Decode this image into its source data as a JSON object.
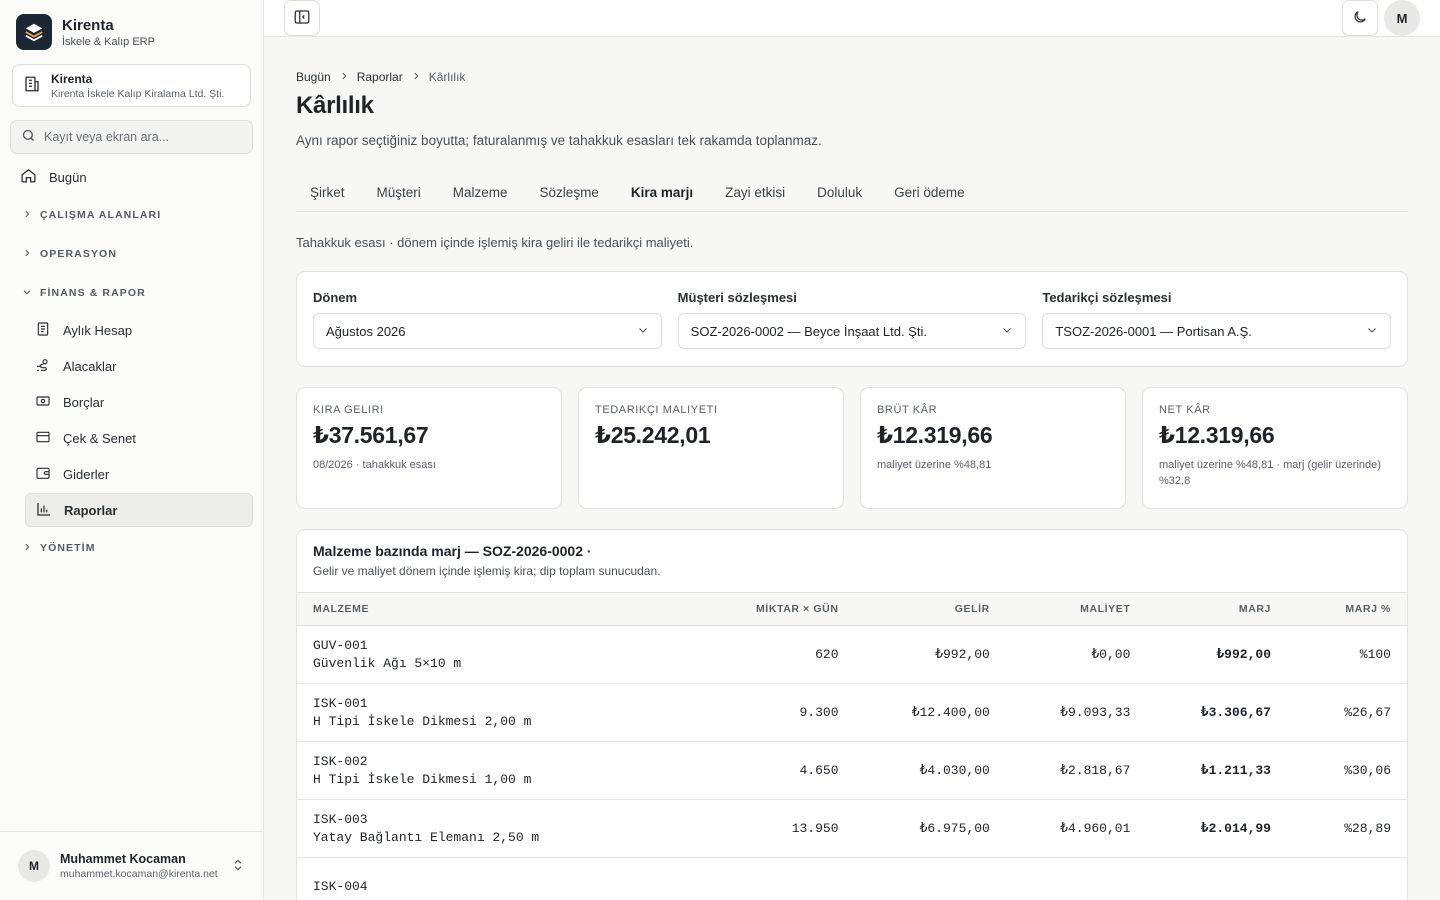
{
  "brand": {
    "name": "Kirenta",
    "subtitle": "İskele & Kalıp ERP"
  },
  "org": {
    "name": "Kirenta",
    "legal_name": "Kirenta İskele Kalıp Kiralama Ltd. Şti."
  },
  "search": {
    "placeholder": "Kayıt veya ekran ara..."
  },
  "nav": {
    "today": "Bugün",
    "sections": {
      "workspaces": "ÇALIŞMA ALANLARI",
      "operations": "OPERASYON",
      "finance": "FİNANS & RAPOR",
      "management": "YÖNETİM"
    },
    "finance_items": [
      "Aylık Hesap",
      "Alacaklar",
      "Borçlar",
      "Çek & Senet",
      "Giderler",
      "Raporlar"
    ],
    "active_item": "Raporlar"
  },
  "user": {
    "initial": "M",
    "name": "Muhammet Kocaman",
    "email": "muhammet.kocaman@kirenta.net"
  },
  "topbar": {
    "avatar_initial": "M"
  },
  "breadcrumb": [
    "Bugün",
    "Raporlar",
    "Kârlılık"
  ],
  "page": {
    "title": "Kârlılık",
    "description": "Aynı rapor seçtiğiniz boyutta; faturalanmış ve tahakkuk esasları tek rakamda toplanmaz."
  },
  "tabs": [
    "Şirket",
    "Müşteri",
    "Malzeme",
    "Sözleşme",
    "Kira marjı",
    "Zayi etkisi",
    "Doluluk",
    "Geri ödeme"
  ],
  "active_tab": "Kira marjı",
  "basis_note": "Tahakkuk esası · dönem içinde işlemiş kira geliri ile tedarikçi maliyeti.",
  "filters": {
    "period": {
      "label": "Dönem",
      "value": "Ağustos 2026"
    },
    "customer_contract": {
      "label": "Müşteri sözleşmesi",
      "value": "SOZ-2026-0002 — Beyce İnşaat Ltd. Şti."
    },
    "supplier_contract": {
      "label": "Tedarikçi sözleşmesi",
      "value": "TSOZ-2026-0001 — Portisan A.Ş."
    }
  },
  "kpis": [
    {
      "label": "Kira geliri",
      "value": "₺37.561,67",
      "sub": "08/2026 · tahakkuk esası"
    },
    {
      "label": "Tedarikçi maliyeti",
      "value": "₺25.242,01",
      "sub": ""
    },
    {
      "label": "Brüt kâr",
      "value": "₺12.319,66",
      "sub": "maliyet üzerine %48,81"
    },
    {
      "label": "Net kâr",
      "value": "₺12.319,66",
      "sub": "maliyet üzerine %48,81 · marj (gelir üzerinde) %32,8"
    }
  ],
  "margin_table": {
    "title": "Malzeme bazında marj — SOZ-2026-0002 ·",
    "subtitle": "Gelir ve maliyet dönem içinde işlemiş kira; dip toplam sunucudan.",
    "columns": [
      "MALZEME",
      "MİKTAR × GÜN",
      "GELİR",
      "MALİYET",
      "MARJ",
      "MARJ %"
    ],
    "rows": [
      {
        "code": "GUV-001",
        "name": "Güvenlik Ağı 5×10 m",
        "qty_days": "620",
        "revenue": "₺992,00",
        "cost": "₺0,00",
        "margin": "₺992,00",
        "margin_pct": "%100"
      },
      {
        "code": "ISK-001",
        "name": "H Tipi İskele Dikmesi 2,00 m",
        "qty_days": "9.300",
        "revenue": "₺12.400,00",
        "cost": "₺9.093,33",
        "margin": "₺3.306,67",
        "margin_pct": "%26,67"
      },
      {
        "code": "ISK-002",
        "name": "H Tipi İskele Dikmesi 1,00 m",
        "qty_days": "4.650",
        "revenue": "₺4.030,00",
        "cost": "₺2.818,67",
        "margin": "₺1.211,33",
        "margin_pct": "%30,06"
      },
      {
        "code": "ISK-003",
        "name": "Yatay Bağlantı Elemanı 2,50 m",
        "qty_days": "13.950",
        "revenue": "₺6.975,00",
        "cost": "₺4.960,01",
        "margin": "₺2.014,99",
        "margin_pct": "%28,89"
      },
      {
        "code": "ISK-004",
        "name": "",
        "qty_days": "",
        "revenue": "",
        "cost": "",
        "margin": "",
        "margin_pct": ""
      }
    ]
  }
}
